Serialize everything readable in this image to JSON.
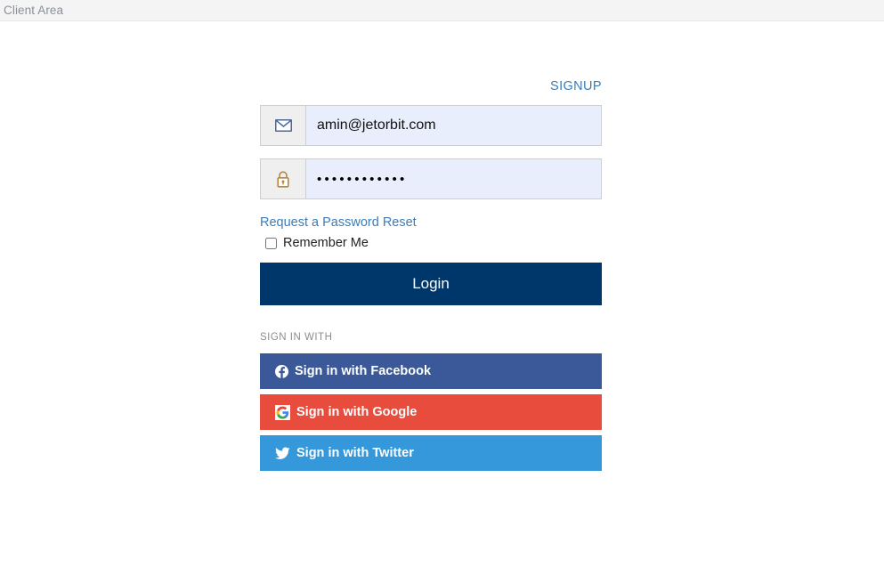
{
  "header": {
    "title": "Client Area"
  },
  "signup": {
    "label": "SIGNUP"
  },
  "form": {
    "email": {
      "value": "amin@jetorbit.com",
      "placeholder": "Email Address",
      "icon": "envelope-icon"
    },
    "password": {
      "value": "••••••••••••",
      "placeholder": "Password",
      "icon": "lock-icon"
    },
    "reset_link": "Request a Password Reset",
    "remember_label": "Remember Me",
    "remember_checked": false,
    "login_label": "Login"
  },
  "social": {
    "heading": "SIGN IN WITH",
    "buttons": [
      {
        "label": "Sign in with Facebook",
        "icon": "facebook-icon",
        "color": "#3b5998"
      },
      {
        "label": "Sign in with Google",
        "icon": "google-icon",
        "color": "#e74c3c"
      },
      {
        "label": "Sign in with Twitter",
        "icon": "twitter-icon",
        "color": "#3498db"
      }
    ]
  },
  "colors": {
    "header_bg": "#f4f4f4",
    "header_text": "#8a8f98",
    "link": "#3d7cb8",
    "login_button": "#00376b",
    "input_bg": "#e8eefb",
    "input_addon_bg": "#efefef",
    "input_border": "#cfcfcf"
  }
}
